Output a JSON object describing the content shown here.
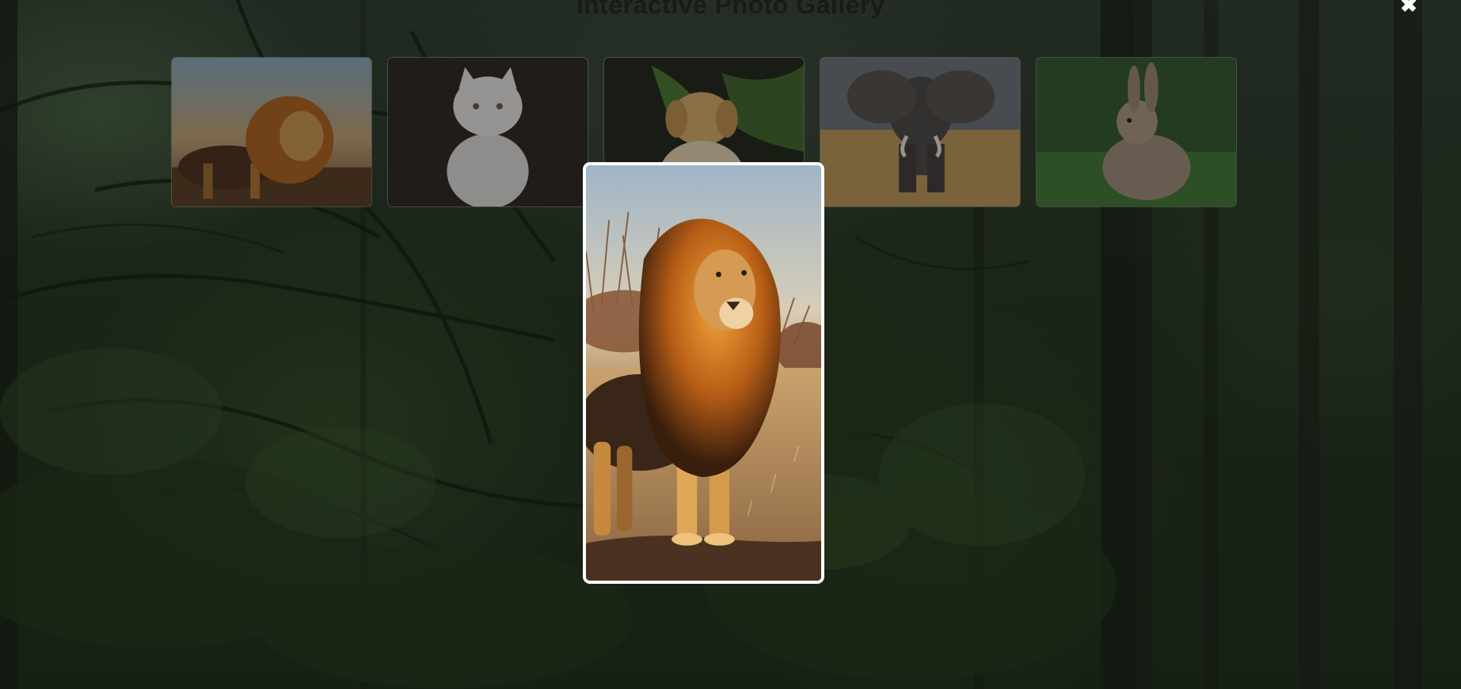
{
  "page": {
    "title": "Interactive Photo Gallery",
    "close_symbol": "✖"
  },
  "gallery": {
    "thumbnails": [
      {
        "subject": "lion",
        "alt": "Lion"
      },
      {
        "subject": "white-kitten",
        "alt": "White kitten"
      },
      {
        "subject": "golden-retriever-puppy",
        "alt": "Golden retriever puppy"
      },
      {
        "subject": "elephant",
        "alt": "Elephant"
      },
      {
        "subject": "rabbit",
        "alt": "Rabbit"
      }
    ]
  },
  "lightbox": {
    "open": true,
    "subject": "lion",
    "alt": "Lion"
  },
  "colors": {
    "overlay": "rgba(12,16,12,0.55)",
    "lightbox_border": "#ffffff"
  },
  "icons": {
    "close": "close-icon"
  }
}
